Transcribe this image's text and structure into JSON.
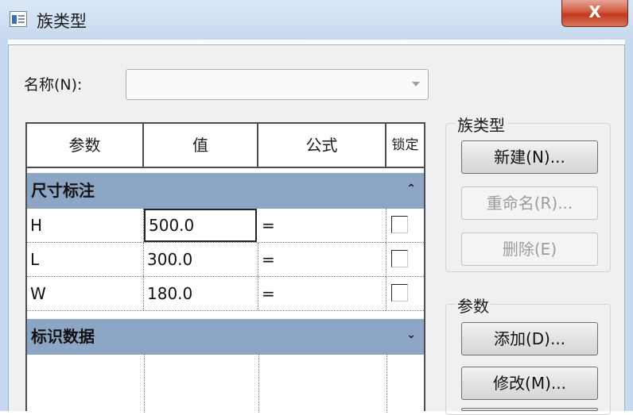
{
  "window": {
    "title": "族类型",
    "close_label": "X"
  },
  "name_field": {
    "label": "名称(N):",
    "value": ""
  },
  "grid": {
    "headers": [
      "参数",
      "值",
      "公式",
      "锁定"
    ],
    "groups": [
      {
        "label": "尺寸标注",
        "toggle": "⌃",
        "rows": [
          {
            "param": "H",
            "value": "500.0",
            "formula": "=",
            "locked": false
          },
          {
            "param": "L",
            "value": "300.0",
            "formula": "=",
            "locked": false
          },
          {
            "param": "W",
            "value": "180.0",
            "formula": "=",
            "locked": false
          }
        ]
      },
      {
        "label": "标识数据",
        "toggle": "⌄",
        "rows": []
      }
    ]
  },
  "family_types": {
    "title": "族类型",
    "buttons": [
      {
        "label": "新建(N)...",
        "enabled": true
      },
      {
        "label": "重命名(R)...",
        "enabled": false
      },
      {
        "label": "删除(E)",
        "enabled": false
      }
    ]
  },
  "parameters": {
    "title": "参数",
    "buttons": [
      {
        "label": "添加(D)...",
        "enabled": true
      },
      {
        "label": "修改(M)...",
        "enabled": true
      }
    ]
  }
}
